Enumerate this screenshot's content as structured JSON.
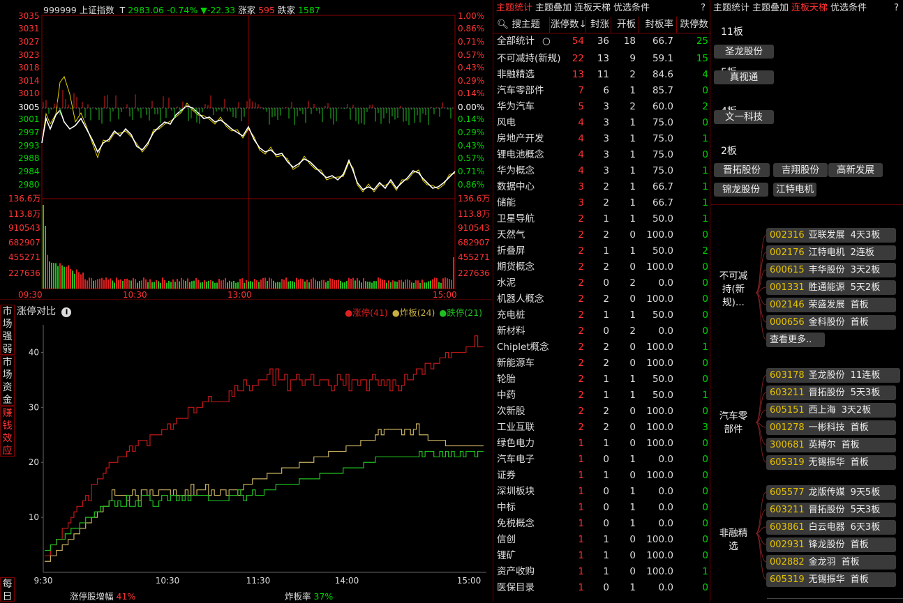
{
  "index_header": {
    "code": "999999",
    "name": "上证指数",
    "t_label": "T",
    "price": "2983.06",
    "pct": "-0.74%",
    "arrow": "▼",
    "change": "-22.33",
    "up_label": "涨家",
    "up_count": "595",
    "down_label": "跌家",
    "down_count": "1587"
  },
  "price_axis_left": [
    "3035",
    "3031",
    "3027",
    "3023",
    "3018",
    "3014",
    "3010",
    "3005",
    "3001",
    "2997",
    "2993",
    "2988",
    "2984",
    "2980"
  ],
  "pct_axis_right": [
    "1.00%",
    "0.86%",
    "0.71%",
    "0.57%",
    "0.43%",
    "0.29%",
    "0.14%",
    "0.00%",
    "0.14%",
    "0.29%",
    "0.43%",
    "0.57%",
    "0.71%",
    "0.86%"
  ],
  "vol_axis": [
    "136.6万",
    "113.8万",
    "910543",
    "682907",
    "455271",
    "227636"
  ],
  "time_axis": [
    "09:30",
    "10:30",
    "13:00",
    "15:00"
  ],
  "limit_chart": {
    "title": "涨停对比",
    "legend": [
      {
        "label": "涨停(41)",
        "color": "#e02020"
      },
      {
        "label": "炸板(24)",
        "color": "#c8b040"
      },
      {
        "label": "跌停(21)",
        "color": "#20c020"
      }
    ],
    "y_ticks": [
      "40",
      "30",
      "20",
      "10"
    ],
    "x_ticks": [
      "9:30",
      "10:30",
      "11:30",
      "14:00",
      "15:00"
    ],
    "footer_left_label": "涨停股增幅",
    "footer_left_value": "41%",
    "footer_right_label": "炸板率",
    "footer_right_value": "37%"
  },
  "side_tabs": [
    "市场强弱",
    "市场资金",
    "赚钱效应",
    "每日"
  ],
  "theme_panel": {
    "tabs": [
      "主题统计",
      "主题叠加",
      "连板天梯",
      "优选条件"
    ],
    "active_tab": 0,
    "help": "?",
    "search_placeholder": "搜主题",
    "columns": [
      "涨停数↓",
      "封涨",
      "开板",
      "封板率",
      "跌停数"
    ],
    "rows": [
      [
        "全部统计",
        "54",
        "36",
        "18",
        "66.7",
        "25"
      ],
      [
        "不可减持(新规)",
        "22",
        "13",
        "9",
        "59.1",
        "15"
      ],
      [
        "非融精选",
        "13",
        "11",
        "2",
        "84.6",
        "4"
      ],
      [
        "汽车零部件",
        "7",
        "6",
        "1",
        "85.7",
        "0"
      ],
      [
        "华为汽车",
        "5",
        "3",
        "2",
        "60.0",
        "2"
      ],
      [
        "风电",
        "4",
        "3",
        "1",
        "75.0",
        "0"
      ],
      [
        "房地产开发",
        "4",
        "3",
        "1",
        "75.0",
        "1"
      ],
      [
        "锂电池概念",
        "4",
        "3",
        "1",
        "75.0",
        "0"
      ],
      [
        "华为概念",
        "4",
        "3",
        "1",
        "75.0",
        "1"
      ],
      [
        "数据中心",
        "3",
        "2",
        "1",
        "66.7",
        "1"
      ],
      [
        "储能",
        "3",
        "2",
        "1",
        "66.7",
        "1"
      ],
      [
        "卫星导航",
        "2",
        "1",
        "1",
        "50.0",
        "1"
      ],
      [
        "天然气",
        "2",
        "2",
        "0",
        "100.0",
        "0"
      ],
      [
        "折叠屏",
        "2",
        "1",
        "1",
        "50.0",
        "2"
      ],
      [
        "期货概念",
        "2",
        "2",
        "0",
        "100.0",
        "0"
      ],
      [
        "水泥",
        "2",
        "0",
        "2",
        "0.0",
        "0"
      ],
      [
        "机器人概念",
        "2",
        "2",
        "0",
        "100.0",
        "0"
      ],
      [
        "充电桩",
        "2",
        "1",
        "1",
        "50.0",
        "0"
      ],
      [
        "新材料",
        "2",
        "0",
        "2",
        "0.0",
        "0"
      ],
      [
        "Chiplet概念",
        "2",
        "2",
        "0",
        "100.0",
        "1"
      ],
      [
        "新能源车",
        "2",
        "2",
        "0",
        "100.0",
        "0"
      ],
      [
        "轮胎",
        "2",
        "1",
        "1",
        "50.0",
        "0"
      ],
      [
        "中药",
        "2",
        "1",
        "1",
        "50.0",
        "1"
      ],
      [
        "次新股",
        "2",
        "2",
        "0",
        "100.0",
        "0"
      ],
      [
        "工业互联",
        "2",
        "2",
        "0",
        "100.0",
        "3"
      ],
      [
        "绿色电力",
        "1",
        "1",
        "0",
        "100.0",
        "0"
      ],
      [
        "汽车电子",
        "1",
        "0",
        "1",
        "0.0",
        "0"
      ],
      [
        "证券",
        "1",
        "1",
        "0",
        "100.0",
        "0"
      ],
      [
        "深圳板块",
        "1",
        "0",
        "1",
        "0.0",
        "0"
      ],
      [
        "中标",
        "1",
        "0",
        "1",
        "0.0",
        "0"
      ],
      [
        "免税概念",
        "1",
        "0",
        "1",
        "0.0",
        "0"
      ],
      [
        "信创",
        "1",
        "1",
        "0",
        "100.0",
        "0"
      ],
      [
        "锂矿",
        "1",
        "1",
        "0",
        "100.0",
        "0"
      ],
      [
        "资产收购",
        "1",
        "1",
        "0",
        "100.0",
        "1"
      ],
      [
        "医保目录",
        "1",
        "0",
        "1",
        "0.0",
        "0"
      ]
    ]
  },
  "ladder_panel": {
    "tabs": [
      "主题统计",
      "主题叠加",
      "连板天梯",
      "优选条件"
    ],
    "active_tab": 2,
    "help": "?",
    "levels": [
      {
        "label": "11板",
        "stocks": [
          "圣龙股份"
        ]
      },
      {
        "label": "5板",
        "stocks": [
          "真视通"
        ]
      },
      {
        "label": "4板",
        "stocks": [
          "文一科技"
        ]
      },
      {
        "label": "2板",
        "stocks": [
          "晋拓股份",
          "吉翔股份",
          "高新发展",
          "锦龙股份",
          "江特电机"
        ]
      }
    ],
    "groups": [
      {
        "name": "不可减持(新规)...",
        "items": [
          [
            "002316",
            "亚联发展",
            "4天3板"
          ],
          [
            "002176",
            "江特电机",
            "2连板"
          ],
          [
            "600615",
            "丰华股份",
            "3天2板"
          ],
          [
            "001331",
            "胜通能源",
            "5天2板"
          ],
          [
            "002146",
            "荣盛发展",
            "首板"
          ],
          [
            "000656",
            "金科股份",
            "首板"
          ]
        ],
        "more": "查看更多.."
      },
      {
        "name": "汽车零部件",
        "items": [
          [
            "603178",
            "圣龙股份",
            "11连板"
          ],
          [
            "603211",
            "晋拓股份",
            "5天3板"
          ],
          [
            "605151",
            "西上海",
            "3天2板"
          ],
          [
            "001278",
            "一彬科技",
            "首板"
          ],
          [
            "300681",
            "英搏尔",
            "首板"
          ],
          [
            "605319",
            "无锡振华",
            "首板"
          ]
        ]
      },
      {
        "name": "非融精选",
        "items": [
          [
            "605577",
            "龙版传媒",
            "9天5板"
          ],
          [
            "603211",
            "晋拓股份",
            "5天3板"
          ],
          [
            "603861",
            "白云电器",
            "6天3板"
          ],
          [
            "002931",
            "锋龙股份",
            "首板"
          ],
          [
            "002882",
            "金龙羽",
            "首板"
          ],
          [
            "605319",
            "无锡振华",
            "首板"
          ]
        ]
      }
    ]
  }
}
